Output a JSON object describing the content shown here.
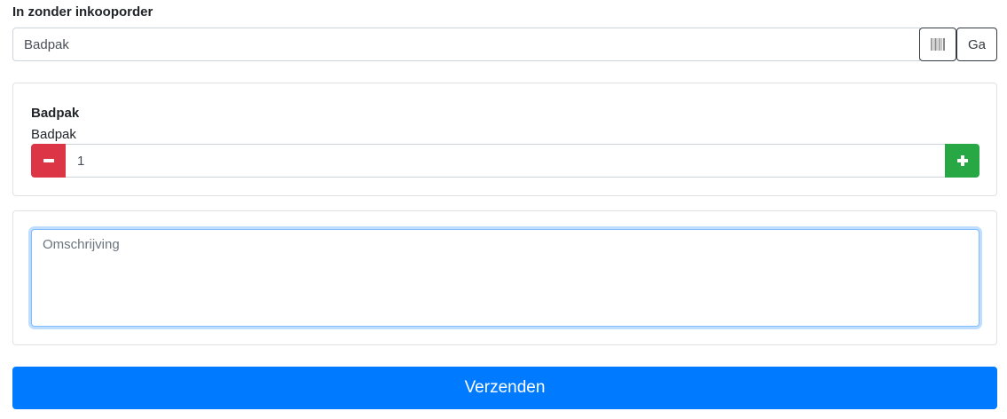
{
  "form": {
    "section_label": "In zonder inkooporder",
    "search": {
      "value": "Badpak",
      "barcode_icon": "barcode-icon",
      "go_label": "Ga"
    },
    "product": {
      "title": "Badpak",
      "subtitle": "Badpak",
      "quantity": "1",
      "minus_icon": "minus-icon",
      "plus_icon": "plus-icon"
    },
    "description": {
      "placeholder": "Omschrijving"
    },
    "submit_label": "Verzenden"
  },
  "colors": {
    "primary": "#007bff",
    "danger": "#dc3545",
    "success": "#28a745",
    "outline_dark": "#343a40"
  }
}
